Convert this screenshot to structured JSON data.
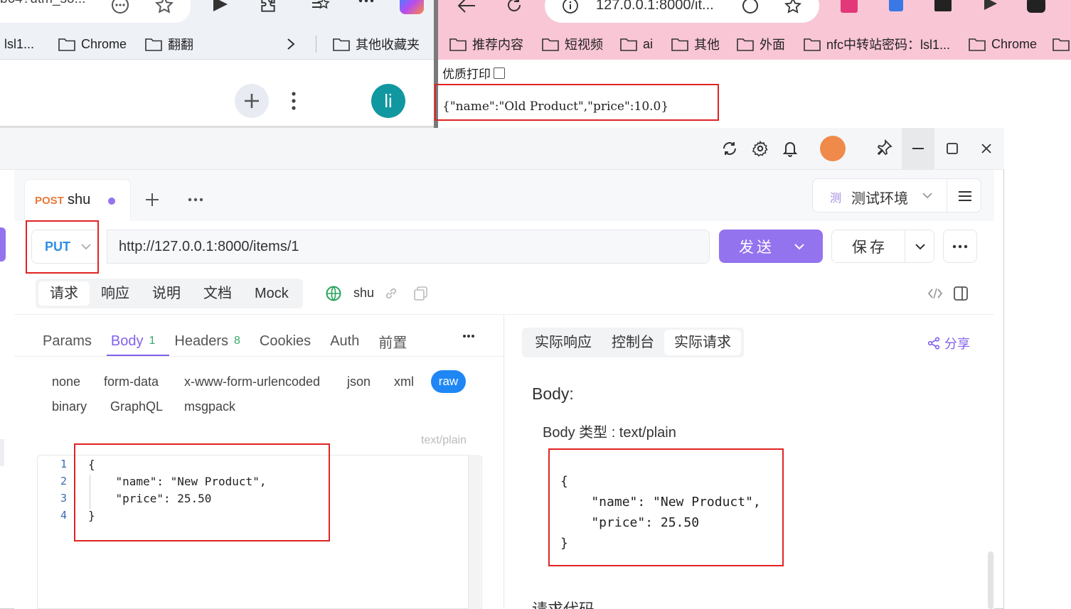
{
  "left_browser": {
    "url_text": "b64?utm_so...",
    "bookmarks": [
      "lsl1...",
      "Chrome",
      "翻翻",
      "其他收藏夹"
    ],
    "avatar_letter": "li"
  },
  "right_browser": {
    "url_text": "127.0.0.1:8000/it...",
    "bookmarks": [
      "推荐内容",
      "短视频",
      "ai",
      "其他",
      "外面",
      "nfc中转站密码：lsl1...",
      "Chrome"
    ],
    "pretty_print_label": "优质打印",
    "response_raw": "{\"name\":\"Old Product\",\"price\":10.0}"
  },
  "app": {
    "request_tab": {
      "method": "POST",
      "name": "shu"
    },
    "environment": {
      "icon_char": "测",
      "name": "测试环境"
    },
    "method": "PUT",
    "url": "http://127.0.0.1:8000/items/1",
    "send_label": "发送",
    "save_label": "保存",
    "view_tabs": [
      "请求",
      "响应",
      "说明",
      "文档",
      "Mock"
    ],
    "env_name_short": "shu",
    "request_subtabs": [
      {
        "label": "Params",
        "count": ""
      },
      {
        "label": "Body",
        "count": "1"
      },
      {
        "label": "Headers",
        "count": "8"
      },
      {
        "label": "Cookies",
        "count": ""
      },
      {
        "label": "Auth",
        "count": ""
      },
      {
        "label": "前置",
        "count": ""
      }
    ],
    "body_types": [
      "none",
      "form-data",
      "x-www-form-urlencoded",
      "json",
      "xml",
      "raw",
      "binary",
      "GraphQL",
      "msgpack"
    ],
    "selected_body_type": "raw",
    "content_type": "text/plain",
    "line_numbers": [
      "1",
      "2",
      "3",
      "4"
    ],
    "code_lines": [
      "{",
      "    \"name\": \"New Product\",",
      "    \"price\": 25.50",
      "}"
    ],
    "response_tabs": [
      "实际响应",
      "控制台",
      "实际请求"
    ],
    "share_label": "分享",
    "body_heading": "Body:",
    "body_type_label": "Body 类型 : text/plain",
    "actual_body_lines": [
      "{",
      "    \"name\": \"New Product\",",
      "    \"price\": 25.50",
      "}"
    ],
    "request_code_label": "请求代码"
  },
  "colors": {
    "accent": "#9373ee",
    "raw_pill": "#1f86f5",
    "highlight": "#e02424",
    "right_browser_bar": "#f9c6d6"
  }
}
